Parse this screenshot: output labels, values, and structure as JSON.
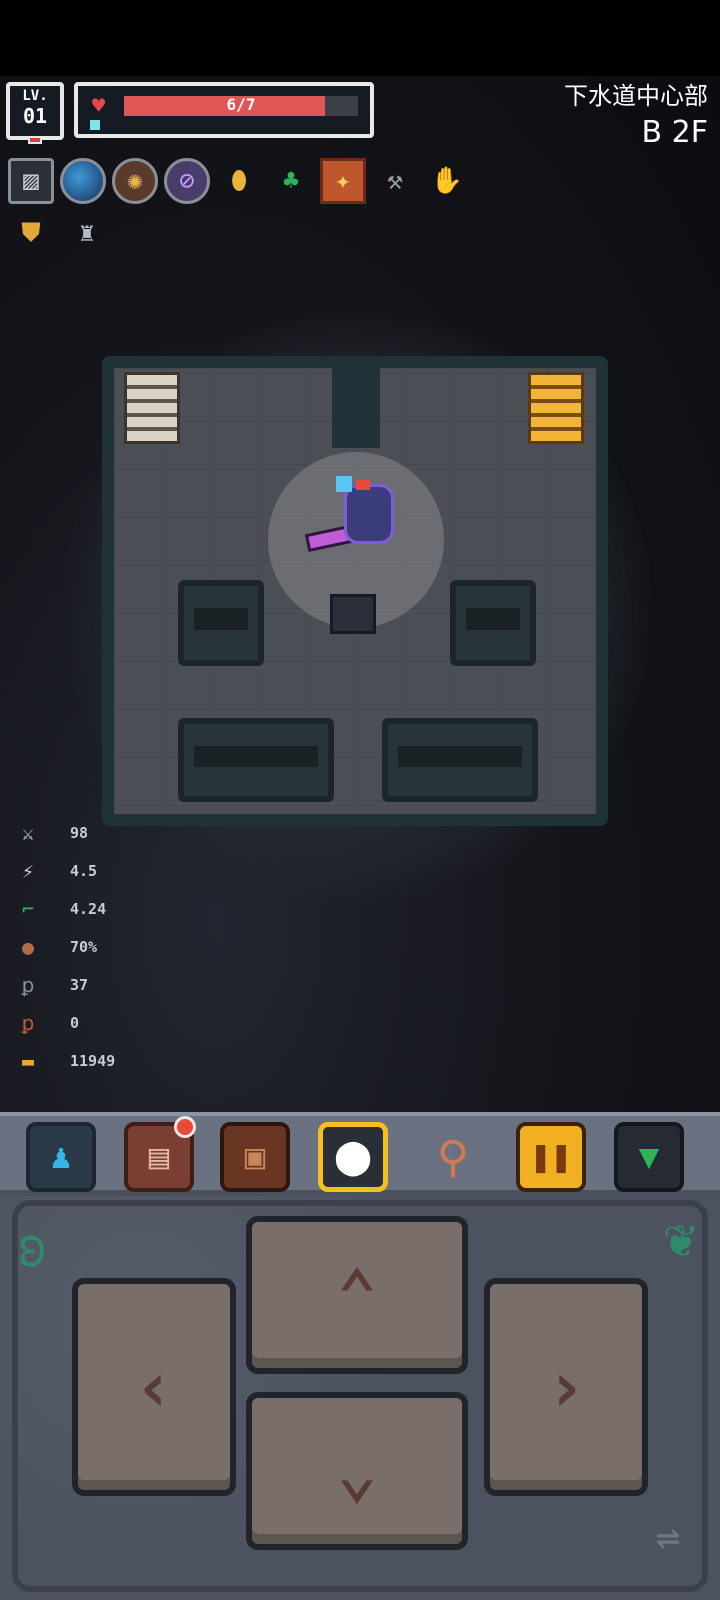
{
  "hud": {
    "level_label": "LV.",
    "level_value": "01",
    "hp_text": "6/7",
    "hp_current": 6,
    "hp_max": 7,
    "location_name": "下水道中心部",
    "floor": "B 2F"
  },
  "equipment": [
    {
      "icon": "slot-icon"
    },
    {
      "icon": "orb-icon"
    },
    {
      "icon": "emblem-icon"
    },
    {
      "icon": "compass-icon"
    },
    {
      "icon": "gold-nugget-icon"
    },
    {
      "icon": "clover-icon"
    },
    {
      "icon": "rune-square-icon"
    },
    {
      "icon": "axe-icon"
    },
    {
      "icon": "gauntlet-icon"
    },
    {
      "icon": "shield-icon"
    },
    {
      "icon": "tower-icon"
    }
  ],
  "stats": [
    {
      "icon": "crossed-swords-icon",
      "value": "98",
      "color": "#c9ccd2"
    },
    {
      "icon": "sword-speed-icon",
      "value": "4.5",
      "color": "#c9ccd2"
    },
    {
      "icon": "boot-icon",
      "value": "4.24",
      "color": "#2fb35a"
    },
    {
      "icon": "round-shield-icon",
      "value": "70%",
      "color": "#b26a48"
    },
    {
      "icon": "key-icon",
      "value": "37",
      "color": "#8a9098"
    },
    {
      "icon": "red-key-icon",
      "value": "0",
      "color": "#c45a3a"
    },
    {
      "icon": "gold-coin-icon",
      "value": "11949",
      "color": "#e0a93a"
    }
  ],
  "toolbar": [
    {
      "name": "character",
      "icon": "person-icon"
    },
    {
      "name": "book",
      "icon": "book-icon",
      "has_badge": true
    },
    {
      "name": "bag",
      "icon": "bag-icon"
    },
    {
      "name": "target",
      "icon": "target-icon",
      "active": true
    },
    {
      "name": "search",
      "icon": "magnifier-icon"
    },
    {
      "name": "pause",
      "icon": "pause-icon"
    },
    {
      "name": "collapse",
      "icon": "down-arrow-icon"
    }
  ],
  "colors": {
    "hp_fill": "#e05555",
    "frame": "#e8e8e8",
    "accent_active": "#f2c11e",
    "room_wall": "#1f3238"
  }
}
